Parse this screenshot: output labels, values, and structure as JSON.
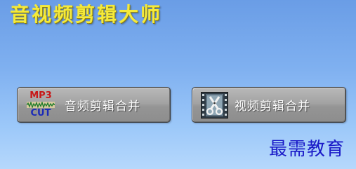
{
  "app": {
    "title": "音视频剪辑大师"
  },
  "buttons": {
    "audio": {
      "label": "音频剪辑合并",
      "icon_top_text": "MP3",
      "icon_bottom_text": "CUT",
      "icon": "mp3-cut-icon"
    },
    "video": {
      "label": "视频剪辑合并",
      "icon": "film-scissors-icon"
    }
  },
  "watermark": {
    "text": "最需教育"
  },
  "colors": {
    "background_top": "#6a9de6",
    "background_bottom": "#b6d8fc",
    "title": "#f5ea3a",
    "button": "#a3a3a3",
    "button_text": "#ffffff",
    "mp3_red": "#c81818",
    "cut_blue": "#1a2ab8",
    "watermark": "#1a1ac8"
  }
}
